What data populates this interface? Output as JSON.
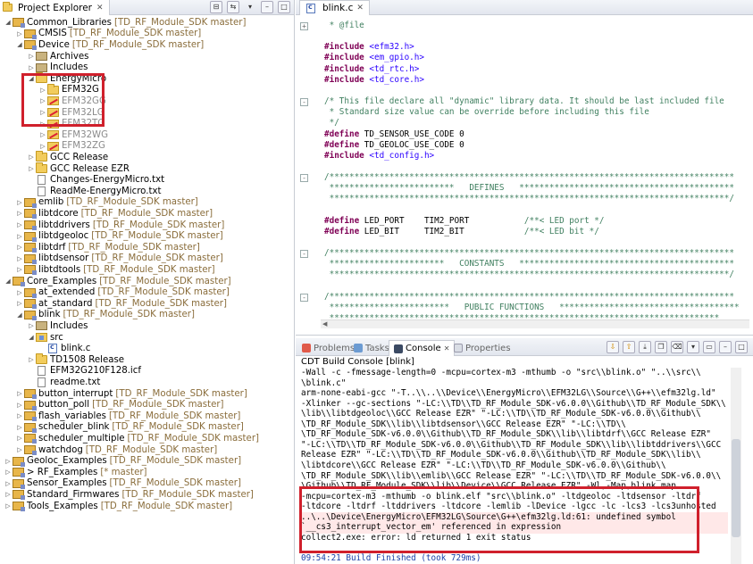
{
  "project_explorer": {
    "title": "Project Explorer",
    "tree": [
      {
        "indent": 0,
        "twisty": "open",
        "icon": "proj",
        "label": "Common_Libraries",
        "dec": "[TD_RF_Module_SDK master]"
      },
      {
        "indent": 1,
        "twisty": "closed",
        "icon": "proj",
        "label": "CMSIS",
        "dec": "[TD_RF_Module_SDK master]"
      },
      {
        "indent": 1,
        "twisty": "open",
        "icon": "proj",
        "label": "Device",
        "dec": "[TD_RF_Module_SDK master]"
      },
      {
        "indent": 2,
        "twisty": "closed",
        "icon": "lib",
        "label": "Archives",
        "dec": ""
      },
      {
        "indent": 2,
        "twisty": "closed",
        "icon": "lib",
        "label": "Includes",
        "dec": ""
      },
      {
        "indent": 2,
        "twisty": "open",
        "icon": "folder",
        "label": "EnergyMicro",
        "dec": ""
      },
      {
        "indent": 3,
        "twisty": "closed",
        "icon": "folder",
        "label": "EFM32G",
        "dec": ""
      },
      {
        "indent": 3,
        "twisty": "closed",
        "icon": "excl",
        "label": "EFM32GG",
        "dec": "",
        "dim": true
      },
      {
        "indent": 3,
        "twisty": "closed",
        "icon": "excl",
        "label": "EFM32LG",
        "dec": "",
        "dim": true
      },
      {
        "indent": 3,
        "twisty": "closed",
        "icon": "excl",
        "label": "EFM32TG",
        "dec": "",
        "dim": true
      },
      {
        "indent": 3,
        "twisty": "closed",
        "icon": "excl",
        "label": "EFM32WG",
        "dec": "",
        "dim": true
      },
      {
        "indent": 3,
        "twisty": "closed",
        "icon": "excl",
        "label": "EFM32ZG",
        "dec": "",
        "dim": true
      },
      {
        "indent": 2,
        "twisty": "closed",
        "icon": "folder",
        "label": "GCC Release",
        "dec": ""
      },
      {
        "indent": 2,
        "twisty": "closed",
        "icon": "folder",
        "label": "GCC Release EZR",
        "dec": ""
      },
      {
        "indent": 2,
        "twisty": "none",
        "icon": "file",
        "label": "Changes-EnergyMicro.txt",
        "dec": ""
      },
      {
        "indent": 2,
        "twisty": "none",
        "icon": "file",
        "label": "ReadMe-EnergyMicro.txt",
        "dec": ""
      },
      {
        "indent": 1,
        "twisty": "closed",
        "icon": "proj",
        "label": "emlib",
        "dec": "[TD_RF_Module_SDK master]"
      },
      {
        "indent": 1,
        "twisty": "closed",
        "icon": "proj",
        "label": "libtdcore",
        "dec": "[TD_RF_Module_SDK master]"
      },
      {
        "indent": 1,
        "twisty": "closed",
        "icon": "proj",
        "label": "libtddrivers",
        "dec": "[TD_RF_Module_SDK master]"
      },
      {
        "indent": 1,
        "twisty": "closed",
        "icon": "proj",
        "label": "libtdgeoloc",
        "dec": "[TD_RF_Module_SDK master]"
      },
      {
        "indent": 1,
        "twisty": "closed",
        "icon": "proj",
        "label": "libtdrf",
        "dec": "[TD_RF_Module_SDK master]"
      },
      {
        "indent": 1,
        "twisty": "closed",
        "icon": "proj",
        "label": "libtdsensor",
        "dec": "[TD_RF_Module_SDK master]"
      },
      {
        "indent": 1,
        "twisty": "closed",
        "icon": "proj",
        "label": "libtdtools",
        "dec": "[TD_RF_Module_SDK master]"
      },
      {
        "indent": 0,
        "twisty": "open",
        "icon": "proj",
        "label": "Core_Examples",
        "dec": "[TD_RF_Module_SDK master]"
      },
      {
        "indent": 1,
        "twisty": "closed",
        "icon": "proj",
        "label": "at_extended",
        "dec": "[TD_RF_Module_SDK master]"
      },
      {
        "indent": 1,
        "twisty": "closed",
        "icon": "proj",
        "label": "at_standard",
        "dec": "[TD_RF_Module_SDK master]"
      },
      {
        "indent": 1,
        "twisty": "open",
        "icon": "proj",
        "label": "blink",
        "dec": "[TD_RF_Module_SDK master]"
      },
      {
        "indent": 2,
        "twisty": "closed",
        "icon": "lib",
        "label": "Includes",
        "dec": ""
      },
      {
        "indent": 2,
        "twisty": "open",
        "icon": "src",
        "label": "src",
        "dec": ""
      },
      {
        "indent": 3,
        "twisty": "none",
        "icon": "cfile",
        "label": "blink.c",
        "dec": ""
      },
      {
        "indent": 2,
        "twisty": "closed",
        "icon": "folder",
        "label": "TD1508 Release",
        "dec": ""
      },
      {
        "indent": 2,
        "twisty": "none",
        "icon": "file",
        "label": "EFM32G210F128.icf",
        "dec": ""
      },
      {
        "indent": 2,
        "twisty": "none",
        "icon": "file",
        "label": "readme.txt",
        "dec": ""
      },
      {
        "indent": 1,
        "twisty": "closed",
        "icon": "proj",
        "label": "button_interrupt",
        "dec": "[TD_RF_Module_SDK master]"
      },
      {
        "indent": 1,
        "twisty": "closed",
        "icon": "proj",
        "label": "button_poll",
        "dec": "[TD_RF_Module_SDK master]"
      },
      {
        "indent": 1,
        "twisty": "closed",
        "icon": "proj",
        "label": "flash_variables",
        "dec": "[TD_RF_Module_SDK master]"
      },
      {
        "indent": 1,
        "twisty": "closed",
        "icon": "proj",
        "label": "scheduler_blink",
        "dec": "[TD_RF_Module_SDK master]"
      },
      {
        "indent": 1,
        "twisty": "closed",
        "icon": "proj",
        "label": "scheduler_multiple",
        "dec": "[TD_RF_Module_SDK master]"
      },
      {
        "indent": 1,
        "twisty": "closed",
        "icon": "proj",
        "label": "watchdog",
        "dec": "[TD_RF_Module_SDK master]"
      },
      {
        "indent": 0,
        "twisty": "closed",
        "icon": "proj",
        "label": "Geoloc_Examples",
        "dec": "[TD_RF_Module_SDK master]"
      },
      {
        "indent": 0,
        "twisty": "closed",
        "icon": "proj",
        "label": "> RF_Examples",
        "dec": "[* master]"
      },
      {
        "indent": 0,
        "twisty": "closed",
        "icon": "proj",
        "label": "Sensor_Examples",
        "dec": "[TD_RF_Module_SDK master]"
      },
      {
        "indent": 0,
        "twisty": "closed",
        "icon": "proj",
        "label": "Standard_Firmwares",
        "dec": "[TD_RF_Module_SDK master]"
      },
      {
        "indent": 0,
        "twisty": "closed",
        "icon": "proj",
        "label": "Tools_Examples",
        "dec": "[TD_RF_Module_SDK master]"
      }
    ]
  },
  "editor": {
    "tab_label": "blink.c",
    "lines": [
      {
        "fold": "+",
        "parts": [
          [
            "cm",
            " * @file"
          ]
        ]
      },
      {
        "parts": [
          [
            "",
            ""
          ]
        ]
      },
      {
        "parts": [
          [
            "pp",
            "#include"
          ],
          [
            "",
            " "
          ],
          [
            "inc",
            "<efm32.h>"
          ]
        ]
      },
      {
        "parts": [
          [
            "pp",
            "#include"
          ],
          [
            "",
            " "
          ],
          [
            "inc",
            "<em_gpio.h>"
          ]
        ]
      },
      {
        "parts": [
          [
            "pp",
            "#include"
          ],
          [
            "",
            " "
          ],
          [
            "inc",
            "<td_rtc.h>"
          ]
        ]
      },
      {
        "parts": [
          [
            "pp",
            "#include"
          ],
          [
            "",
            " "
          ],
          [
            "inc",
            "<td_core.h>"
          ]
        ]
      },
      {
        "parts": [
          [
            "",
            ""
          ]
        ]
      },
      {
        "fold": "-",
        "parts": [
          [
            "cm",
            "/* This file declare all \"dynamic\" library data. It should be last included file"
          ]
        ]
      },
      {
        "parts": [
          [
            "cm",
            " * Standard size value can be override before including this file"
          ]
        ]
      },
      {
        "parts": [
          [
            "cm",
            " */"
          ]
        ]
      },
      {
        "parts": [
          [
            "pp",
            "#define"
          ],
          [
            "",
            " TD_SENSOR_USE_CODE 0"
          ]
        ]
      },
      {
        "parts": [
          [
            "pp",
            "#define"
          ],
          [
            "",
            " TD_GEOLOC_USE_CODE 0"
          ]
        ]
      },
      {
        "parts": [
          [
            "pp",
            "#include"
          ],
          [
            "",
            " "
          ],
          [
            "inc",
            "<td_config.h>"
          ]
        ]
      },
      {
        "parts": [
          [
            "",
            ""
          ]
        ]
      },
      {
        "fold": "-",
        "parts": [
          [
            "cm",
            "/*********************************************************************************"
          ]
        ]
      },
      {
        "parts": [
          [
            "cm",
            " *************************   DEFINES   *******************************************"
          ]
        ]
      },
      {
        "parts": [
          [
            "cm",
            " ********************************************************************************/"
          ]
        ]
      },
      {
        "parts": [
          [
            "",
            ""
          ]
        ]
      },
      {
        "parts": [
          [
            "pp",
            "#define"
          ],
          [
            "",
            " LED_PORT    TIM2_PORT           "
          ],
          [
            "cm",
            "/**< LED port */"
          ]
        ]
      },
      {
        "parts": [
          [
            "pp",
            "#define"
          ],
          [
            "",
            " LED_BIT     TIM2_BIT            "
          ],
          [
            "cm",
            "/**< LED bit */"
          ]
        ]
      },
      {
        "parts": [
          [
            "",
            ""
          ]
        ]
      },
      {
        "fold": "-",
        "parts": [
          [
            "cm",
            "/*********************************************************************************"
          ]
        ]
      },
      {
        "parts": [
          [
            "cm",
            " ***********************   CONSTANTS   *******************************************"
          ]
        ]
      },
      {
        "parts": [
          [
            "cm",
            " ********************************************************************************/"
          ]
        ]
      },
      {
        "parts": [
          [
            "",
            ""
          ]
        ]
      },
      {
        "fold": "-",
        "parts": [
          [
            "cm",
            "/*********************************************************************************"
          ]
        ]
      },
      {
        "parts": [
          [
            "cm",
            " ************************   PUBLIC FUNCTIONS   ************************************"
          ]
        ]
      },
      {
        "parts": [
          [
            "cm",
            " ******************************************************************************"
          ]
        ]
      }
    ]
  },
  "panels": {
    "tabs": [
      {
        "label": "Problems",
        "active": false
      },
      {
        "label": "Tasks",
        "active": false
      },
      {
        "label": "Console",
        "active": true
      },
      {
        "label": "Properties",
        "active": false
      }
    ],
    "console_title": "CDT Build Console [blink]",
    "console_lines": [
      {
        "text": "-Wall -c -fmessage-length=0 -mcpu=cortex-m3 -mthumb -o \"src\\\\blink.o\" \"..\\\\src\\\\",
        "kind": ""
      },
      {
        "text": "\\blink.c\"",
        "kind": ""
      },
      {
        "text": "arm-none-eabi-gcc \"-T..\\\\..\\\\Device\\\\EnergyMicro\\\\EFM32LG\\\\Source\\\\G++\\\\efm32lg.ld\"",
        "kind": ""
      },
      {
        "text": "-Xlinker --gc-sections \"-LC:\\\\TD\\\\TD_RF_Module_SDK-v6.0.0\\\\Github\\\\TD_RF_Module_SDK\\\\",
        "kind": ""
      },
      {
        "text": "\\lib\\\\libtdgeoloc\\\\GCC Release EZR\" \"-LC:\\\\TD\\\\TD_RF_Module_SDK-v6.0.0\\\\Github\\\\",
        "kind": ""
      },
      {
        "text": "\\TD_RF_Module_SDK\\\\lib\\\\libtdsensor\\\\GCC Release EZR\" \"-LC:\\\\TD\\\\",
        "kind": ""
      },
      {
        "text": "\\TD_RF_Module_SDK-v6.0.0\\\\Github\\\\TD_RF_Module_SDK\\\\lib\\\\libtdrf\\\\GCC Release EZR\"",
        "kind": ""
      },
      {
        "text": "\"-LC:\\\\TD\\\\TD_RF_Module_SDK-v6.0.0\\\\Github\\\\TD_RF_Module_SDK\\\\lib\\\\libtddrivers\\\\GCC",
        "kind": ""
      },
      {
        "text": "Release EZR\" \"-LC:\\\\TD\\\\TD_RF_Module_SDK-v6.0.0\\\\Github\\\\TD_RF_Module_SDK\\\\lib\\\\",
        "kind": ""
      },
      {
        "text": "\\libtdcore\\\\GCC Release EZR\" \"-LC:\\\\TD\\\\TD_RF_Module_SDK-v6.0.0\\\\Github\\\\",
        "kind": ""
      },
      {
        "text": "\\TD_RF_Module_SDK\\\\lib\\\\emlib\\\\GCC Release EZR\" \"-LC:\\\\TD\\\\TD_RF_Module_SDK-v6.0.0\\\\",
        "kind": ""
      },
      {
        "text": "\\Github\\\\TD_RF_Module_SDK\\\\lib\\\\Device\\\\GCC Release EZR\" -Wl,-Map,blink.map",
        "kind": ""
      },
      {
        "text": "-mcpu=cortex-m3 -mthumb -o blink.elf \"src\\\\blink.o\" -ltdgeoloc -ltdsensor -ltdrf",
        "kind": ""
      },
      {
        "text": "-ltdcore -ltdrf -ltddrivers -ltdcore -lemlib -lDevice -lgcc -lc -lcs3 -lcs3unhosted",
        "kind": ""
      },
      {
        "text": "..\\..\\Device\\EnergyMicro\\EFM32LG\\Source\\G++\\efm32lg.ld:61: undefined symbol",
        "kind": "hl"
      },
      {
        "text": "`__cs3_interrupt_vector_em' referenced in expression",
        "kind": "hl"
      },
      {
        "text": "collect2.exe: error: ld returned 1 exit status",
        "kind": ""
      },
      {
        "text": "",
        "kind": ""
      },
      {
        "text": "09:54:21 Build Finished (took 729ms)",
        "kind": "blue"
      }
    ]
  }
}
